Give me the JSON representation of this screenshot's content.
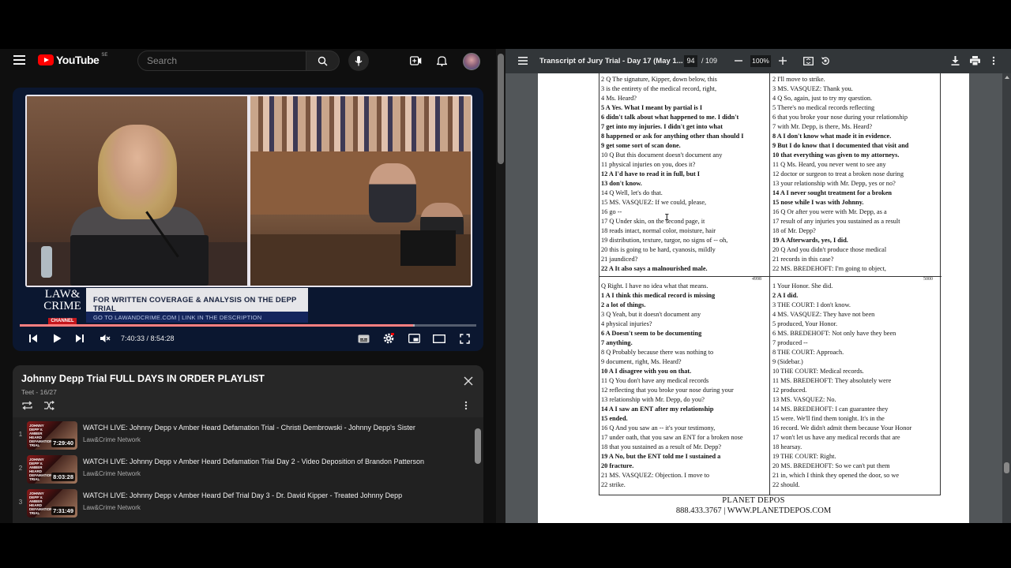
{
  "youtube": {
    "logo_text": "YouTube",
    "country_code": "SE",
    "search_placeholder": "Search",
    "player": {
      "banner_title": "FOR WRITTEN COVERAGE & ANALYSIS ON THE DEPP TRIAL",
      "banner_sub": "GO TO LAWANDCRIME.COM | LINK IN THE DESCRIPTION",
      "logo_line1": "LAW&",
      "logo_line2": "CRIME",
      "logo_channel": "CHANNEL",
      "time_current": "7:40:33",
      "time_total": "8:54:28",
      "time_display": "7:40:33 / 8:54:28",
      "progress_fraction": 0.862,
      "buffered_fraction": 0.865
    },
    "playlist": {
      "title": "Johnny Depp Trial FULL DAYS IN ORDER PLAYLIST",
      "subtitle": "Teet - 16/27",
      "items": [
        {
          "num": "1",
          "title": "WATCH LIVE: Johnny Depp v Amber Heard Defamation Trial - Christi Dembrowski - Johnny Depp's Sister",
          "channel": "Law&Crime Network",
          "duration": "7:29:40",
          "thumb_tag": "JOHNNY DEPP V. AMBER HEARD DEFAMATION TRIAL"
        },
        {
          "num": "2",
          "title": "WATCH LIVE: Johnny Depp v Amber Heard Defamation Trial Day 2 - Video Deposition of Brandon Patterson",
          "channel": "Law&Crime Network",
          "duration": "8:03:28",
          "thumb_tag": "JOHNNY DEPP V. AMBER HEARD DEFAMATION TRIAL"
        },
        {
          "num": "3",
          "title": "WATCH LIVE: Johnny Depp v Amber Heard Def Trial Day 3 - Dr. David Kipper - Treated Johnny Depp",
          "channel": "Law&Crime Network",
          "duration": "7:31:49",
          "thumb_tag": "JOHNNY DEPP V. AMBER HEARD DEFAMATION TRIAL"
        }
      ]
    }
  },
  "pdf": {
    "title": "Transcript of Jury Trial - Day 17 (May 1...",
    "page_current": "94",
    "page_total": "/ 109",
    "zoom": "100%",
    "page_labels": {
      "tl": "4998",
      "tr": "5000"
    },
    "footer_line1": "PLANET DEPOS",
    "footer_line2": "888.433.3767 | WWW.PLANETDEPOS.COM",
    "quad_tl": [
      {
        "t": "2      Q    The signature, Kipper, down below, this",
        "b": false
      },
      {
        "t": "3   is the entirety of the medical record, right,",
        "b": false
      },
      {
        "t": "4   Ms. Heard?",
        "b": false
      },
      {
        "t": "5      A    Yes.  What I meant by partial is I",
        "b": true
      },
      {
        "t": "6   didn't talk about what happened to me.  I didn't",
        "b": true
      },
      {
        "t": "7   get into my injuries.  I didn't get into what",
        "b": true
      },
      {
        "t": "8   happened or ask for anything other than should I",
        "b": true
      },
      {
        "t": "9   get some sort of scan done.",
        "b": true
      },
      {
        "t": "10     Q    But this document doesn't document any",
        "b": false
      },
      {
        "t": "11 physical injuries on you, does it?",
        "b": false
      },
      {
        "t": "12     A    I'd have to read it in full, but I",
        "b": true
      },
      {
        "t": "13 don't know.",
        "b": true
      },
      {
        "t": "14     Q    Well, let's do that.",
        "b": false
      },
      {
        "t": "15          MS. VASQUEZ:  If we could, please,",
        "b": false
      },
      {
        "t": "16 go --",
        "b": false
      },
      {
        "t": "17     Q    Under skin, on the second page, it",
        "b": false
      },
      {
        "t": "18 reads intact, normal color, moisture, hair",
        "b": false
      },
      {
        "t": "19 distribution, texture, turgor, no signs of -- oh,",
        "b": false
      },
      {
        "t": "20 this is going to be hard, cyanosis, mildly",
        "b": false
      },
      {
        "t": "21 jaundiced?",
        "b": false
      },
      {
        "t": "22     A    It also says a malnourished male.",
        "b": true
      }
    ],
    "quad_tr": [
      {
        "t": "2   I'll move to strike.",
        "b": false
      },
      {
        "t": "3          MS. VASQUEZ:  Thank you.",
        "b": false
      },
      {
        "t": "4      Q    So, again, just to try my question.",
        "b": false
      },
      {
        "t": "5          There's no medical records reflecting",
        "b": false
      },
      {
        "t": "6   that you broke your nose during your relationship",
        "b": false
      },
      {
        "t": "7   with Mr. Depp, is there, Ms. Heard?",
        "b": false
      },
      {
        "t": "8      A    I don't know what made it in evidence.",
        "b": true
      },
      {
        "t": "9   But I do know that I documented that visit and",
        "b": true
      },
      {
        "t": "10 that everything was given to my attorneys.",
        "b": true
      },
      {
        "t": "11     Q    Ms. Heard, you never went to see any",
        "b": false
      },
      {
        "t": "12 doctor or surgeon to treat a broken nose during",
        "b": false
      },
      {
        "t": "13 your relationship with Mr. Depp, yes or no?",
        "b": false
      },
      {
        "t": "14     A    I never sought treatment for a broken",
        "b": true
      },
      {
        "t": "15 nose while I was with Johnny.",
        "b": true
      },
      {
        "t": "16     Q    Or after you were with Mr. Depp, as a",
        "b": false
      },
      {
        "t": "17 result of any injuries you sustained as a result",
        "b": false
      },
      {
        "t": "18 of Mr. Depp?",
        "b": false
      },
      {
        "t": "19     A    Afterwards, yes, I did.",
        "b": true
      },
      {
        "t": "20     Q    And you didn't produce those medical",
        "b": false
      },
      {
        "t": "21 records in this case?",
        "b": false
      },
      {
        "t": "22          MS. BREDEHOFT:  I'm going to object,",
        "b": false
      }
    ],
    "quad_bl": [
      {
        "t": "        Q    Right.  I have no idea what that means.",
        "b": false
      },
      {
        "t": "1      A    I think this medical record is missing",
        "b": true
      },
      {
        "t": "2   a lot of things.",
        "b": true
      },
      {
        "t": "3      Q    Yeah, but it doesn't document any",
        "b": false
      },
      {
        "t": "4   physical injuries?",
        "b": false
      },
      {
        "t": "6      A    Doesn't seem to be documenting",
        "b": true
      },
      {
        "t": "7   anything.",
        "b": true
      },
      {
        "t": "8      Q    Probably because there was nothing to",
        "b": false
      },
      {
        "t": "9   document, right, Ms. Heard?",
        "b": false
      },
      {
        "t": "10     A    I disagree with you on that.",
        "b": true
      },
      {
        "t": "11     Q    You don't have any medical records",
        "b": false
      },
      {
        "t": "12 reflecting that you broke your nose during your",
        "b": false
      },
      {
        "t": "13 relationship with Mr. Depp, do you?",
        "b": false
      },
      {
        "t": "14     A    I saw an ENT after my relationship",
        "b": true
      },
      {
        "t": "15 ended.",
        "b": true
      },
      {
        "t": "16     Q    And you saw an -- it's your testimony,",
        "b": false
      },
      {
        "t": "17 under oath, that you saw an ENT for a broken nose",
        "b": false
      },
      {
        "t": "18 that you sustained as a result of Mr. Depp?",
        "b": false
      },
      {
        "t": "19     A    No, but the ENT told me I sustained a",
        "b": true
      },
      {
        "t": "20 fracture.",
        "b": true
      },
      {
        "t": "21          MS. VASQUEZ:  Objection.  I move to",
        "b": false
      },
      {
        "t": "22 strike.",
        "b": false
      }
    ],
    "quad_br": [
      {
        "t": "1   Your Honor.  She did.",
        "b": false
      },
      {
        "t": "2      A    I did.",
        "b": true
      },
      {
        "t": "3          THE COURT:  I don't know.",
        "b": false
      },
      {
        "t": "4          MS. VASQUEZ:  They have not been",
        "b": false
      },
      {
        "t": "5   produced, Your Honor.",
        "b": false
      },
      {
        "t": "6          MS. BREDEHOFT:  Not only have they been",
        "b": false
      },
      {
        "t": "7   produced --",
        "b": false
      },
      {
        "t": "8          THE COURT:  Approach.",
        "b": false
      },
      {
        "t": "9          (Sidebar.)",
        "b": false
      },
      {
        "t": "10        THE COURT:  Medical records.",
        "b": false
      },
      {
        "t": "11        MS. BREDEHOFT:  They absolutely were",
        "b": false
      },
      {
        "t": "12 produced.",
        "b": false
      },
      {
        "t": "13        MS. VASQUEZ:  No.",
        "b": false
      },
      {
        "t": "14        MS. BREDEHOFT:  I can guarantee they",
        "b": false
      },
      {
        "t": "15 were.  We'll find them tonight.  It's in the",
        "b": false
      },
      {
        "t": "16 record.  We didn't admit them because Your Honor",
        "b": false
      },
      {
        "t": "17 won't let us have any medical records that are",
        "b": false
      },
      {
        "t": "18 hearsay.",
        "b": false
      },
      {
        "t": "19        THE COURT:  Right.",
        "b": false
      },
      {
        "t": "20        MS. BREDEHOFT:  So we can't put them",
        "b": false
      },
      {
        "t": "21 in, which I think they opened the door, so we",
        "b": false
      },
      {
        "t": "22 should.",
        "b": false
      }
    ]
  }
}
